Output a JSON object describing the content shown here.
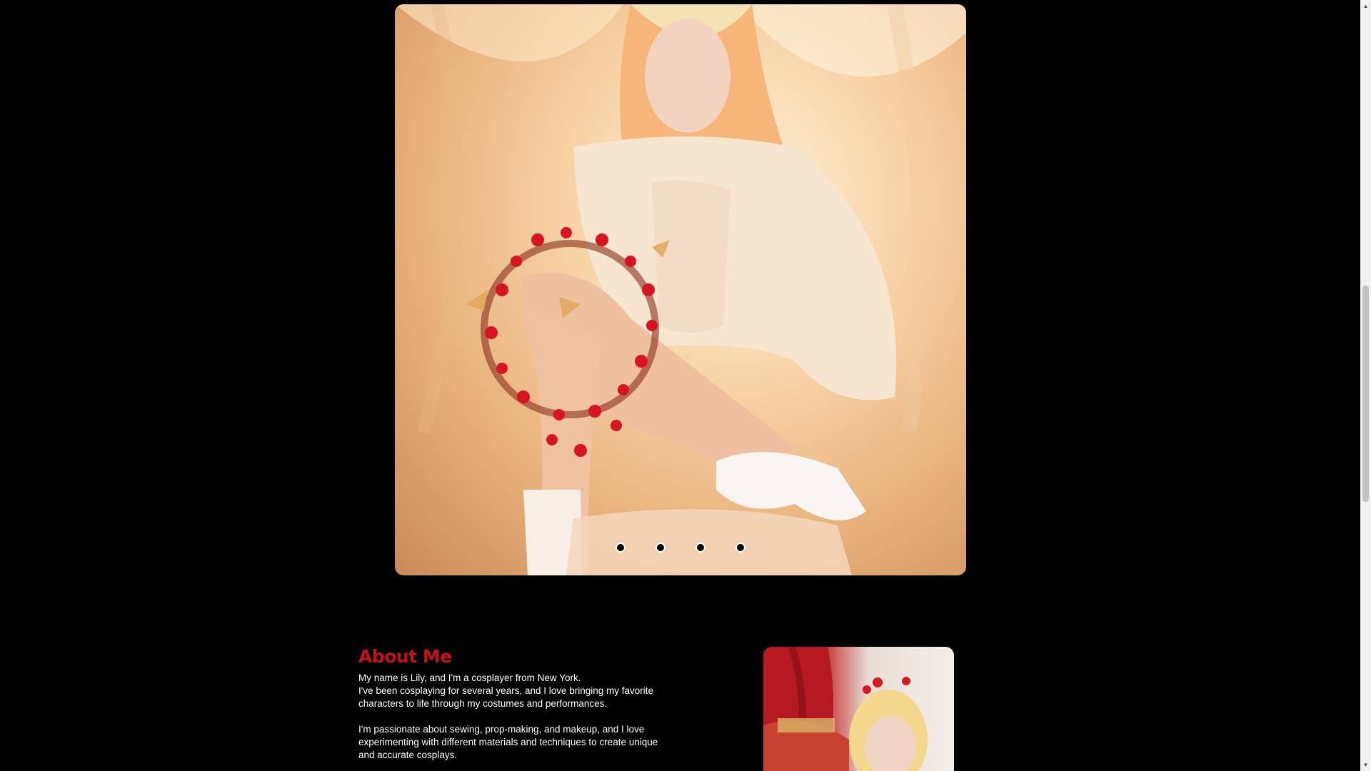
{
  "carousel": {
    "slide_count": 4,
    "dots": [
      "slide-1",
      "slide-2",
      "slide-3",
      "slide-4"
    ]
  },
  "about": {
    "title": "About Me",
    "paragraph_1": "My name is Lily, and I'm a cosplayer from New York.\nI've been cosplaying for several years, and I love bringing my favorite characters to life through my costumes and performances.",
    "paragraph_2": "I'm passionate about sewing, prop-making, and makeup, and I love experimenting with different materials and techniques to create unique and accurate cosplays."
  },
  "colors": {
    "background": "#000000",
    "accent": "#c4121b",
    "text": "#ffffff"
  },
  "scrollbar": {
    "up_icon": "chevron-up-icon",
    "down_icon": "chevron-down-icon"
  }
}
